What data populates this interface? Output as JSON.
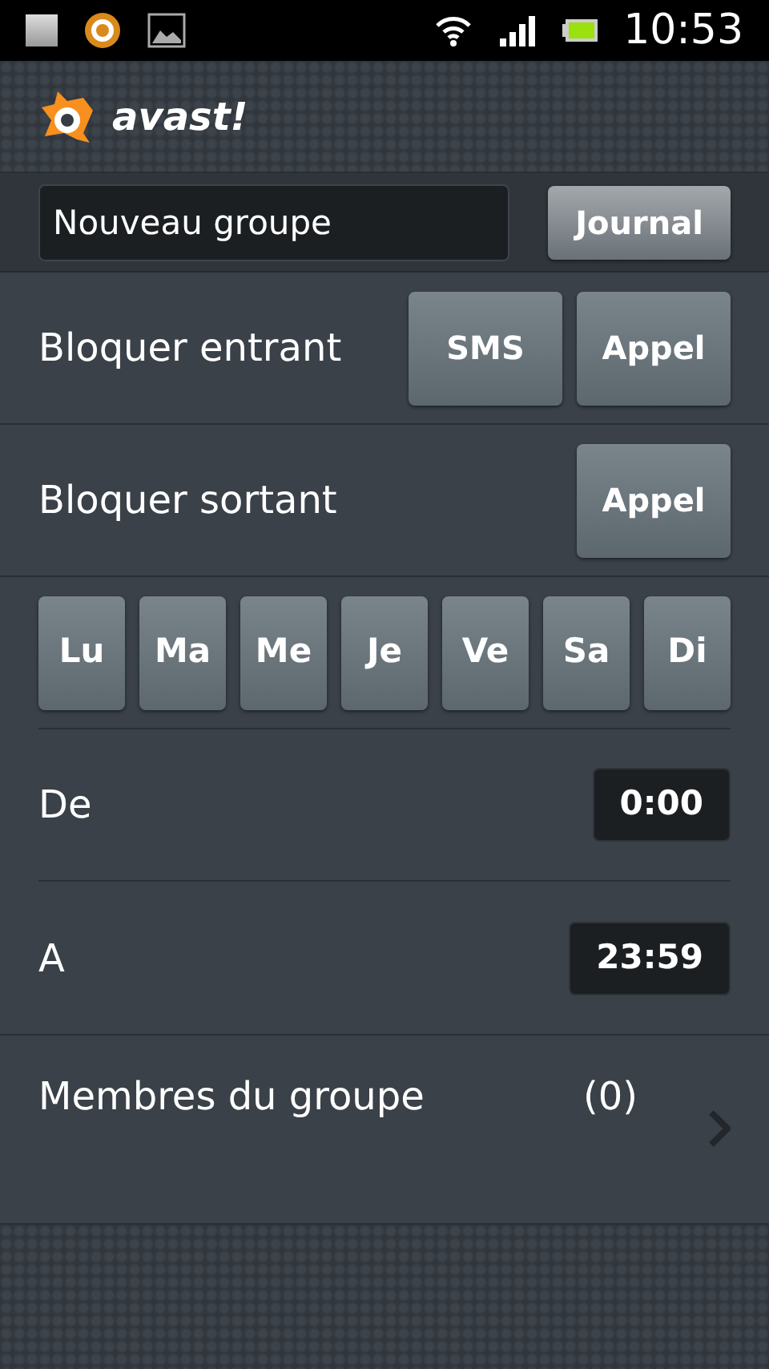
{
  "status_bar": {
    "time": "10:53"
  },
  "header": {
    "logo_text": "avast!"
  },
  "group": {
    "name": "Nouveau groupe",
    "journal_button": "Journal"
  },
  "block_rows": [
    {
      "label": "Bloquer entrant",
      "buttons": [
        "SMS",
        "Appel"
      ]
    },
    {
      "label": "Bloquer sortant",
      "buttons": [
        "Appel"
      ]
    }
  ],
  "days": [
    "Lu",
    "Ma",
    "Me",
    "Je",
    "Ve",
    "Sa",
    "Di"
  ],
  "time_rows": [
    {
      "label": "De",
      "value": "0:00"
    },
    {
      "label": "A",
      "value": "23:59"
    }
  ],
  "members": {
    "label": "Membres du groupe",
    "count": "(0)"
  }
}
